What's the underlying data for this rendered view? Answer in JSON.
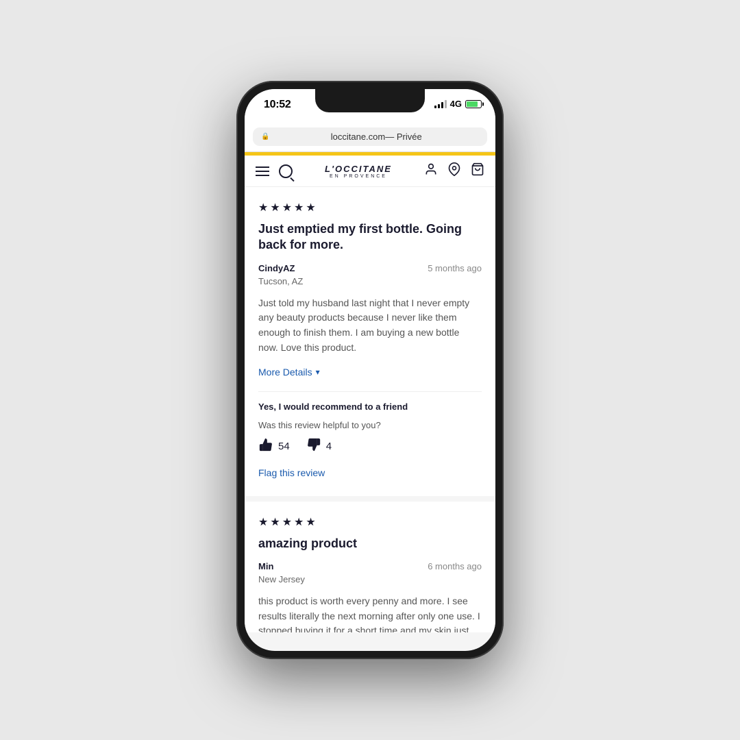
{
  "phone": {
    "status_bar": {
      "time": "10:52",
      "network": "4G"
    },
    "browser": {
      "url": "loccitane.com",
      "privacy": "— Privée",
      "lock_icon": "🔒"
    },
    "nav": {
      "logo_line1": "L'OCCITANE",
      "logo_line2": "EN PROVENCE"
    }
  },
  "review1": {
    "stars": 5,
    "title": "Just emptied my first bottle. Going back for more.",
    "reviewer_name": "CindyAZ",
    "reviewer_location": "Tucson, AZ",
    "date": "5 months ago",
    "body": "Just told my husband last night that I never empty any beauty products because I never like them enough to finish them. I am buying a new bottle now. Love this product.",
    "more_details_label": "More Details",
    "recommend_text": "Yes, I would recommend to a friend",
    "helpful_question": "Was this review helpful to you?",
    "thumbs_up_count": "54",
    "thumbs_down_count": "4",
    "flag_label": "Flag this review"
  },
  "review2": {
    "stars": 5,
    "title": "amazing product",
    "reviewer_name": "Min",
    "reviewer_location": "New Jersey",
    "date": "6 months ago",
    "body": "this product is worth every penny and more. I see results literally the next morning after only one use. I stopped buying it for a short time and my skin just didn't look the same. I highly, highly recommend this product."
  }
}
